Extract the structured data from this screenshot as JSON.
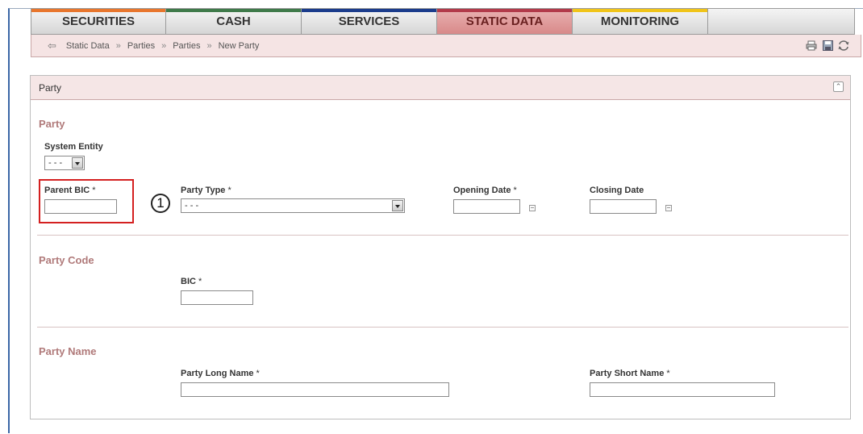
{
  "tabs": [
    {
      "label": "SECURITIES",
      "bar_color": "#e8762d"
    },
    {
      "label": "CASH",
      "bar_color": "#3f7a4a"
    },
    {
      "label": "SERVICES",
      "bar_color": "#1b3c8c"
    },
    {
      "label": "STATIC DATA",
      "bar_color": "#b23a4a",
      "active": true
    },
    {
      "label": "MONITORING",
      "bar_color": "#f0c419"
    }
  ],
  "breadcrumb": {
    "items": [
      "Static Data",
      "Parties",
      "Parties",
      "New Party"
    ],
    "separator": "»"
  },
  "panel": {
    "title": "Party"
  },
  "sections": {
    "party": {
      "title": "Party",
      "system_entity": {
        "label": "System Entity",
        "value": "- - -"
      },
      "parent_bic": {
        "label": "Parent BIC",
        "required": "*",
        "value": ""
      },
      "party_type": {
        "label": "Party Type",
        "required": "*",
        "value": "- - -"
      },
      "opening_date": {
        "label": "Opening Date",
        "required": "*",
        "value": ""
      },
      "closing_date": {
        "label": "Closing Date",
        "value": ""
      }
    },
    "party_code": {
      "title": "Party Code",
      "bic": {
        "label": "BIC",
        "required": "*",
        "value": ""
      }
    },
    "party_name": {
      "title": "Party Name",
      "long_name": {
        "label": "Party Long Name",
        "required": "*",
        "value": ""
      },
      "short_name": {
        "label": "Party Short Name",
        "required": "*",
        "value": ""
      }
    }
  },
  "annotation": {
    "marker": "1",
    "highlight_color": "#d42020"
  }
}
